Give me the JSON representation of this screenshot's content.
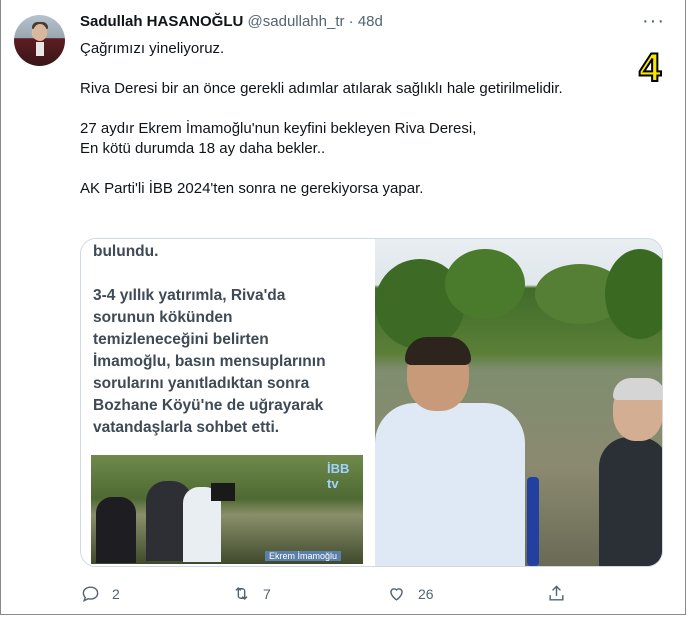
{
  "tweet": {
    "author_name": "Sadullah HASANOĞLU",
    "author_handle": "@sadullahh_tr",
    "separator": "·",
    "time": "48d",
    "more_label": "···",
    "badge_number": "4",
    "body_lines": [
      "Çağrımızı yineliyoruz.",
      "",
      "Riva Deresi bir an önce gerekli adımlar atılarak sağlıklı hale getirilmelidir.",
      "",
      "27 aydır Ekrem İmamoğlu'nun keyfini bekleyen Riva Deresi,",
      "En kötü durumda 18 ay daha bekler..",
      "",
      "AK Parti'li İBB 2024'ten sonra ne gerekiyorsa yapar."
    ]
  },
  "media": {
    "left_text_lines": [
      "bulundu.",
      "",
      "3-4 yıllık yatırımla, Riva'da",
      "sorunun kökünden",
      "temizleneceğini belirten",
      "İmamoğlu, basın mensuplarının",
      "sorularını yanıtladıktan sonra",
      "Bozhane Köyü'ne de uğrayarak",
      "vatandaşlarla sohbet etti."
    ],
    "small_photo_logo": "İBB tv",
    "small_photo_caption": "Ekrem İmamoğlu"
  },
  "actions": {
    "reply": {
      "icon": "reply-icon",
      "count": "2"
    },
    "retweet": {
      "icon": "retweet-icon",
      "count": "7"
    },
    "like": {
      "icon": "heart-icon",
      "count": "26"
    },
    "share": {
      "icon": "share-icon"
    }
  },
  "colors": {
    "badge": "#f6e600",
    "secondary_text": "#536471"
  }
}
